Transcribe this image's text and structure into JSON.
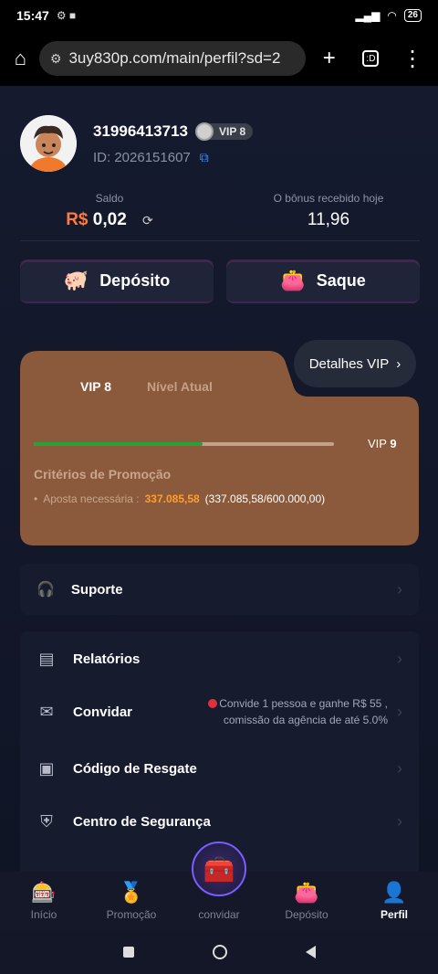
{
  "statusbar": {
    "time": "15:47",
    "battery": "26"
  },
  "browser": {
    "url": "3uy830p.com/main/perfil?sd=2",
    "new_tab": "+",
    "menu": "⋮"
  },
  "profile": {
    "phone": "31996413713",
    "vip_badge": "VIP 8",
    "id_text": "ID: 2026151607"
  },
  "balance": {
    "label": "Saldo",
    "currency": "R$",
    "amount": "0,02",
    "bonus_label": "O bônus recebido hoje",
    "bonus_value": "11,96"
  },
  "actions": {
    "deposit": "Depósito",
    "withdraw": "Saque"
  },
  "vip": {
    "current_prefix": "VIP",
    "current_level": "8",
    "level_label": "Nível Atual",
    "details": "Detalhes VIP",
    "next_label": "VIP",
    "next_level": "9",
    "progress_fraction": 0.563,
    "criteria_title": "Critérios de Promoção",
    "bet_label": "Aposta necessária :",
    "bet_value": "337.085,58",
    "bet_total": "(337.085,58/600.000,00)"
  },
  "menu": {
    "support": "Suporte",
    "reports": "Relatórios",
    "invite": "Convidar",
    "invite_note_1": "Convide 1 pessoa e ganhe R$ 55 ,",
    "invite_note_2": "comissão da agência de até 5.0%",
    "redeem": "Código de Resgate",
    "security": "Centro de Segurança"
  },
  "bottomnav": {
    "home": "Início",
    "promo": "Promoção",
    "invite": "convidar",
    "deposit": "Depósito",
    "profile": "Perfil"
  },
  "colors": {
    "accent_orange": "#ff7a3c",
    "vip_card": "#8b5a3c",
    "progress": "#2aa135",
    "link_blue": "#3a8cff"
  }
}
